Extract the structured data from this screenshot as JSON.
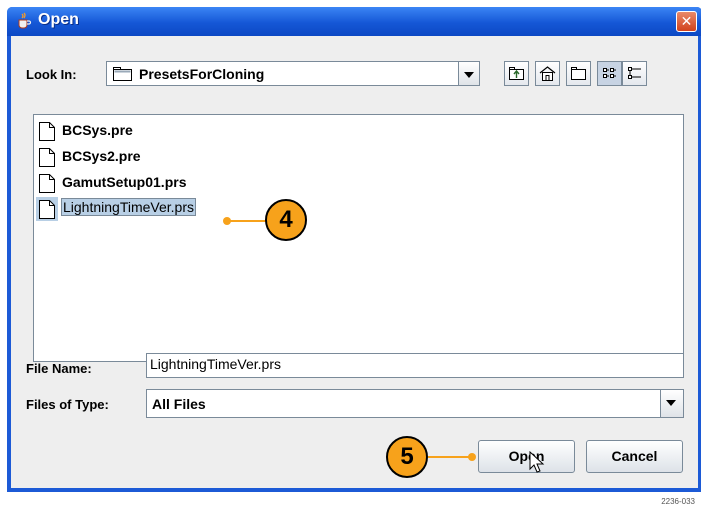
{
  "window": {
    "title": "Open",
    "close_glyph": "✕"
  },
  "look_in": {
    "label": "Look In:",
    "value": "PresetsForCloning"
  },
  "toolbar": {
    "icons": [
      "up-one-level-icon",
      "home-icon",
      "new-folder-icon",
      "list-view-icon",
      "details-view-icon"
    ]
  },
  "files": [
    {
      "name": "BCSys.pre",
      "selected": false
    },
    {
      "name": "BCSys2.pre",
      "selected": false
    },
    {
      "name": "GamutSetup01.prs",
      "selected": false
    },
    {
      "name": "LightningTimeVer.prs",
      "selected": true
    }
  ],
  "file_name": {
    "label": "File Name:",
    "value": "LightningTimeVer.prs"
  },
  "files_of_type": {
    "label": "Files of Type:",
    "value": "All Files"
  },
  "buttons": {
    "open": "Open",
    "cancel": "Cancel"
  },
  "callouts": {
    "step4": "4",
    "step5": "5"
  },
  "figure_id": "2236-033",
  "colors": {
    "titlebar": "#1c5ad6",
    "callout": "#f7a21b",
    "selection": "#b8cfe5"
  }
}
